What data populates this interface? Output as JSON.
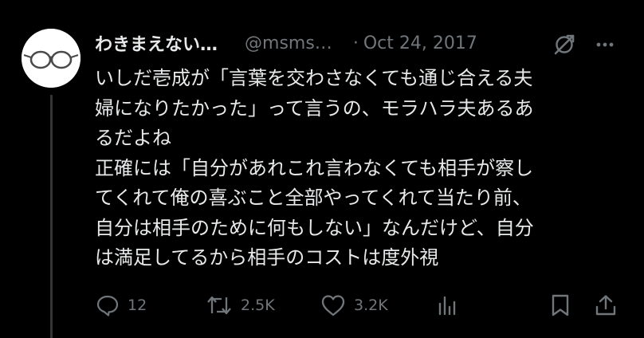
{
  "tweet": {
    "display_name": "わきまえない…",
    "handle": "@msms…",
    "separator": "·",
    "timestamp": "Oct 24, 2017",
    "text": "いしだ壱成が「言葉を交わさなくても通じ合える夫\n婦になりたかった」って言うの、モラハラ夫あるあ\nるだよね\n正確には「自分があれこれ言わなくても相手が察し\nてくれて俺の喜ぶこと全部やってくれて当たり前、\n自分は相手のために何もしない」なんだけど、自分\nは満足してるから相手のコストは度外視"
  },
  "actions": {
    "replies": "12",
    "reposts": "2.5K",
    "likes": "3.2K"
  },
  "icons": {
    "avatar": "glasses-avatar",
    "grok": "grok-icon",
    "more": "more-icon",
    "reply": "reply-icon",
    "repost": "repost-icon",
    "like": "heart-icon",
    "views": "bar-chart-icon",
    "bookmark": "bookmark-icon",
    "share": "share-icon"
  },
  "colors": {
    "background": "#000000",
    "text": "#e7e9ea",
    "secondary": "#71767b",
    "thread_line": "#333639"
  }
}
